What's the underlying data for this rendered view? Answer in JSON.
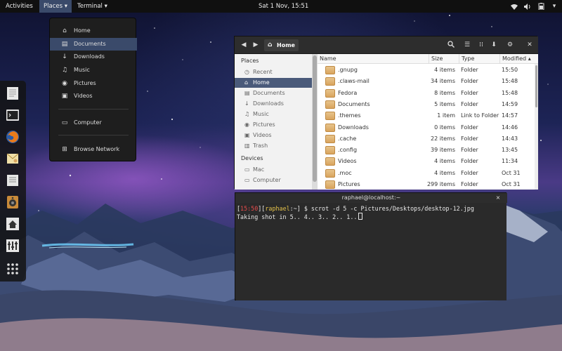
{
  "topbar": {
    "activities": "Activities",
    "places": "Places ▾",
    "terminal": "Terminal ▾",
    "clock": "Sat  1 Nov, 15:51",
    "tray_icons": [
      "wifi-icon",
      "volume-icon",
      "battery-icon"
    ]
  },
  "places_menu": {
    "items": [
      {
        "label": "Home",
        "icon": "home-icon"
      },
      {
        "label": "Documents",
        "icon": "document-icon"
      },
      {
        "label": "Downloads",
        "icon": "download-icon"
      },
      {
        "label": "Music",
        "icon": "music-icon"
      },
      {
        "label": "Pictures",
        "icon": "camera-icon"
      },
      {
        "label": "Videos",
        "icon": "video-icon"
      },
      {
        "label": "Computer",
        "icon": "computer-icon"
      },
      {
        "label": "Browse Network",
        "icon": "network-icon"
      }
    ],
    "active_index": 1
  },
  "dash": {
    "items": [
      "text-editor-icon",
      "terminal-icon",
      "firefox-icon",
      "mail-icon",
      "document-viewer-icon",
      "speaker-icon",
      "network-home-icon",
      "settings-icon",
      "show-apps-icon"
    ]
  },
  "file_manager": {
    "path_label": "Home",
    "sidebar": {
      "places_heading": "Places",
      "places": [
        {
          "label": "Recent",
          "icon": "clock-icon"
        },
        {
          "label": "Home",
          "icon": "home-icon"
        },
        {
          "label": "Documents",
          "icon": "document-icon"
        },
        {
          "label": "Downloads",
          "icon": "download-icon"
        },
        {
          "label": "Music",
          "icon": "music-icon"
        },
        {
          "label": "Pictures",
          "icon": "camera-icon"
        },
        {
          "label": "Videos",
          "icon": "video-icon"
        },
        {
          "label": "Trash",
          "icon": "trash-icon"
        }
      ],
      "active_index": 1,
      "devices_heading": "Devices",
      "devices": [
        {
          "label": "Mac",
          "icon": "drive-icon"
        },
        {
          "label": "Computer",
          "icon": "computer-icon"
        }
      ]
    },
    "columns": {
      "name": "Name",
      "size": "Size",
      "type": "Type",
      "modified": "Modified"
    },
    "rows": [
      {
        "name": ".gnupg",
        "size": "4 items",
        "type": "Folder",
        "modified": "15:50"
      },
      {
        "name": ".claws-mail",
        "size": "34 items",
        "type": "Folder",
        "modified": "15:48"
      },
      {
        "name": "Fedora",
        "size": "8 items",
        "type": "Folder",
        "modified": "15:48"
      },
      {
        "name": "Documents",
        "size": "5 items",
        "type": "Folder",
        "modified": "14:59"
      },
      {
        "name": ".themes",
        "size": "1 item",
        "type": "Link to Folder",
        "modified": "14:57"
      },
      {
        "name": "Downloads",
        "size": "0 items",
        "type": "Folder",
        "modified": "14:46"
      },
      {
        "name": ".cache",
        "size": "22 items",
        "type": "Folder",
        "modified": "14:43"
      },
      {
        "name": ".config",
        "size": "39 items",
        "type": "Folder",
        "modified": "13:45"
      },
      {
        "name": "Videos",
        "size": "4 items",
        "type": "Folder",
        "modified": "11:34"
      },
      {
        "name": ".moc",
        "size": "4 items",
        "type": "Folder",
        "modified": "Oct 31"
      },
      {
        "name": "Pictures",
        "size": "299 items",
        "type": "Folder",
        "modified": "Oct 31"
      }
    ]
  },
  "terminal": {
    "title": "raphael@localhost:~",
    "close": "×",
    "prompt_time": "15:50",
    "prompt_user": "raphael",
    "prompt_path": "~",
    "command": "$ scrot -d 5 -c Pictures/Desktops/desktop-12.jpg",
    "output": "Taking shot in 5.. 4.. 3.. 2.. 1.."
  }
}
